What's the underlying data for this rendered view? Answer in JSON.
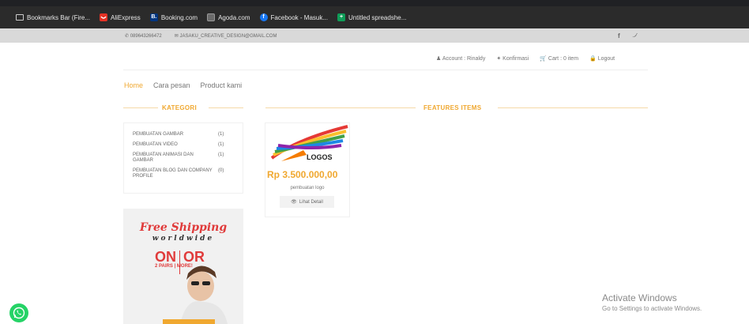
{
  "browser": {
    "bookmarks": [
      {
        "label": "Bookmarks Bar (Fire...",
        "icon": "folder-icon",
        "color": "#9aa0a6"
      },
      {
        "label": "AliExpress",
        "icon": "aliexpress-icon",
        "color": "#e43225"
      },
      {
        "label": "Booking.com",
        "icon": "booking-icon",
        "color": "#003580",
        "glyph": "B."
      },
      {
        "label": "Agoda.com",
        "icon": "agoda-icon",
        "color": "#5a5a5a"
      },
      {
        "label": "Facebook - Masuk...",
        "icon": "facebook-icon",
        "color": "#1877f2",
        "glyph": "f"
      },
      {
        "label": "Untitled spreadshe...",
        "icon": "sheets-icon",
        "color": "#0f9d58",
        "glyph": "+"
      }
    ]
  },
  "topbar": {
    "phone": "089643266472",
    "email": "JASAKU_CREATIVE_DESIGN@GMAIL.COM"
  },
  "account": {
    "account": "Account : Rinaldy",
    "confirm": "Konfirmasi",
    "cart": "Cart : 0 item",
    "logout": "Logout"
  },
  "nav": {
    "home": "Home",
    "how_to_order": "Cara pesan",
    "products": "Product kami"
  },
  "categories": {
    "title": "KATEGORI",
    "items": [
      {
        "name": "PEMBUATAN GAMBAR",
        "count": "(1)"
      },
      {
        "name": "PEMBUATAN VIDEO",
        "count": "(1)"
      },
      {
        "name": "PEMBUATAN ANIMASI DAN GAMBAR",
        "count": "(1)"
      },
      {
        "name": "PEMBUATAN BLOG DAN COMPANY PROFILE",
        "count": "(0)"
      }
    ]
  },
  "features": {
    "title": "FEATURES ITEMS",
    "product": {
      "image_text": "LOGOS",
      "price": "Rp 3.500.000,00",
      "name": "pembuatan logo",
      "button": "Lihat Detail"
    }
  },
  "ad": {
    "line1": "Free Shipping",
    "line2": "worldwide",
    "on": "ON",
    "or": "OR",
    "sub": "2 PAIRS | MORE!"
  },
  "windows": {
    "line1": "Activate Windows",
    "line2": "Go to Settings to activate Windows."
  },
  "colors": {
    "accent": "#f0a830"
  }
}
